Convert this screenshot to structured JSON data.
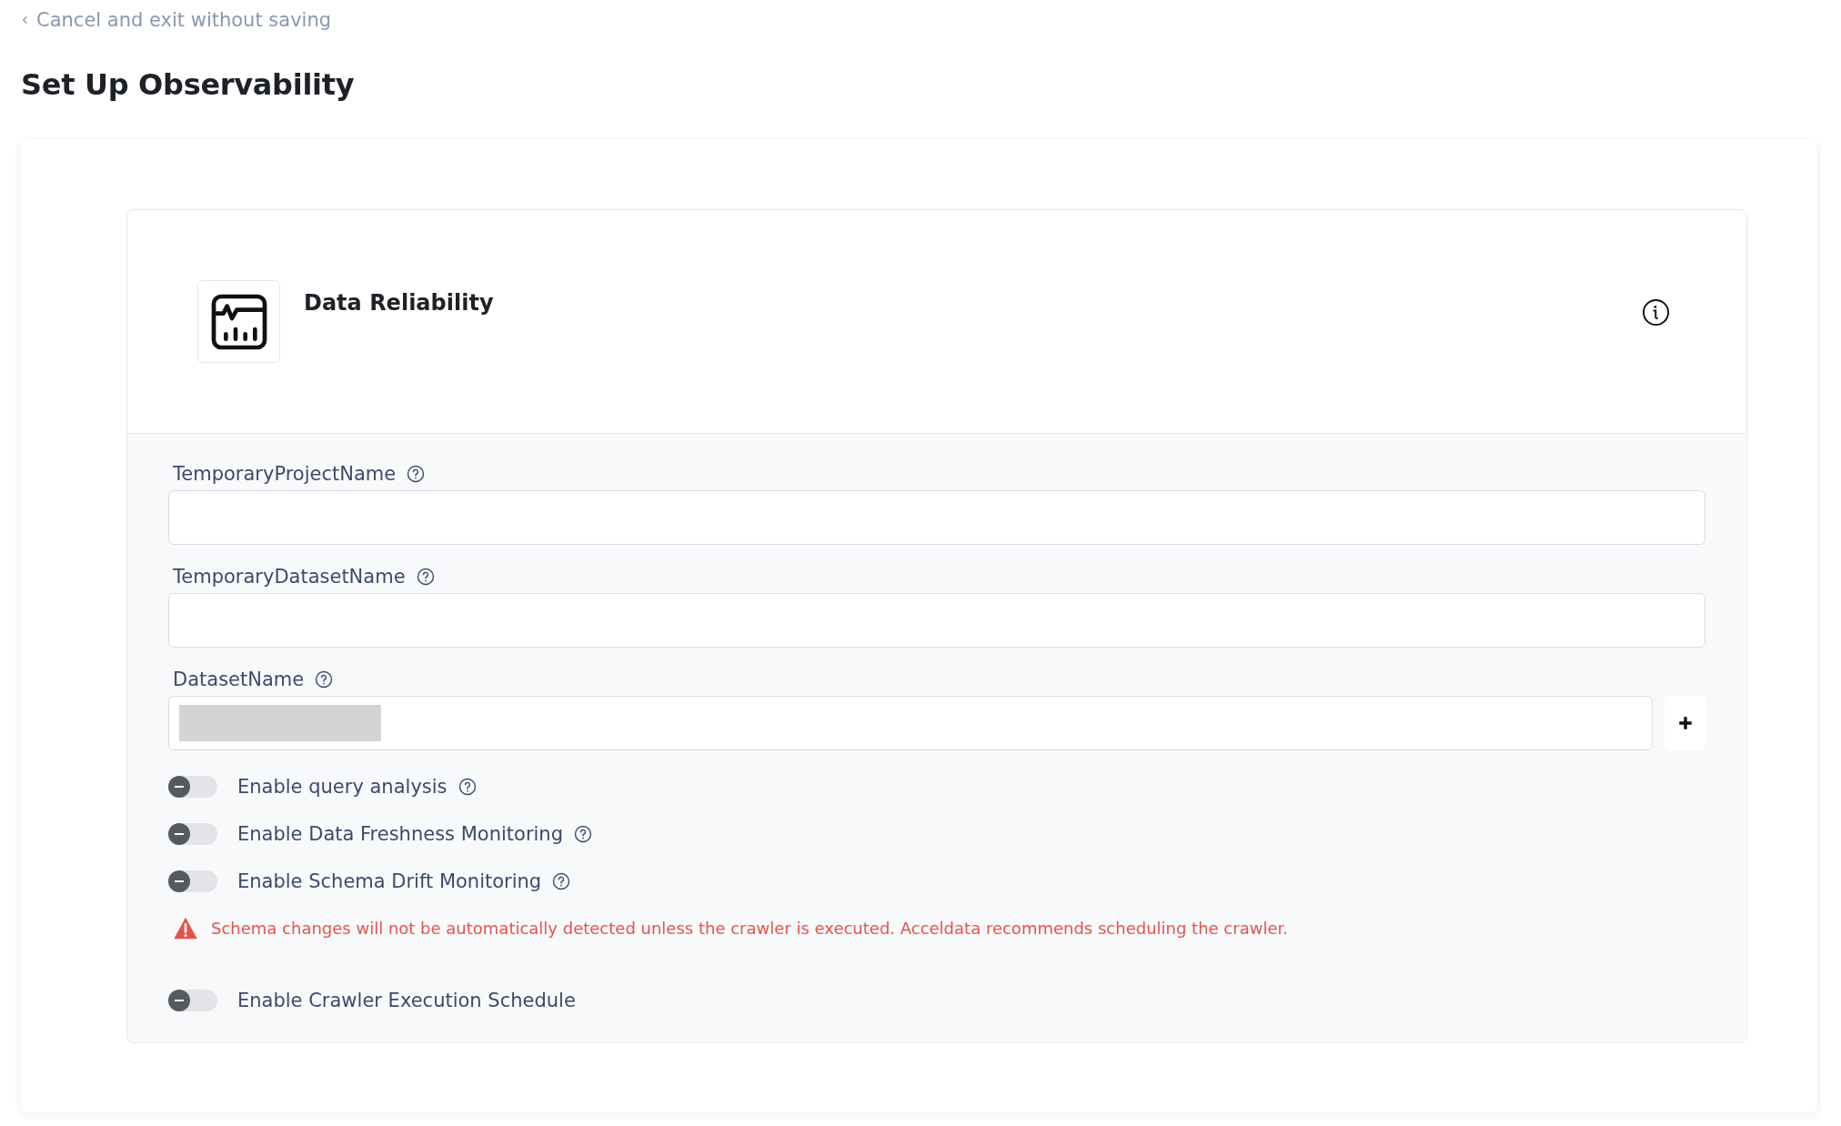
{
  "back_link": {
    "label": "Cancel and exit without saving"
  },
  "page_title": "Set Up Observability",
  "card": {
    "title": "Data Reliability",
    "fields": [
      {
        "label": "TemporaryProjectName",
        "kind": "text"
      },
      {
        "label": "TemporaryDatasetName",
        "kind": "text"
      },
      {
        "label": "DatasetName",
        "kind": "select-add"
      }
    ],
    "toggles": [
      {
        "label": "Enable query analysis",
        "on": false,
        "help": true
      },
      {
        "label": "Enable Data Freshness Monitoring",
        "on": false,
        "help": true
      },
      {
        "label": "Enable Schema Drift Monitoring",
        "on": false,
        "help": true
      }
    ],
    "warning": "Schema changes will not be automatically detected unless the crawler is executed. Acceldata recommends scheduling the crawler.",
    "extra_toggles": [
      {
        "label": "Enable Crawler Execution Schedule",
        "on": false,
        "help": false
      }
    ]
  }
}
